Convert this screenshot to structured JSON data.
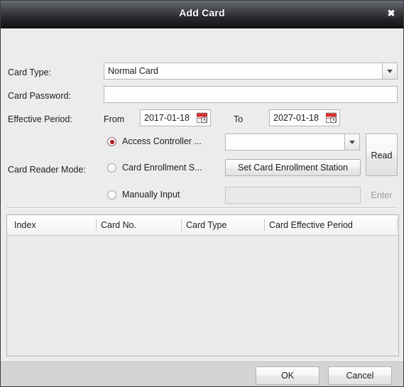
{
  "window": {
    "title": "Add Card",
    "close_icon": "close-icon",
    "close_glyph": "✖"
  },
  "form": {
    "card_type": {
      "label": "Card Type:",
      "value": "Normal Card",
      "arrow_icon": "chevron-down-icon"
    },
    "card_password": {
      "label": "Card Password:",
      "value": "",
      "placeholder": ""
    },
    "effective_period": {
      "label": "Effective Period:",
      "from_label": "From",
      "from_value": "2017-01-18",
      "to_label": "To",
      "to_value": "2027-01-18",
      "calendar_icon": "calendar-icon"
    },
    "card_reader_mode": {
      "label": "Card Reader Mode:",
      "options": [
        {
          "label": "Access Controller ...",
          "selected": true,
          "control": "combo",
          "value": "",
          "arrow_icon": "chevron-down-icon"
        },
        {
          "label": "Card Enrollment S...",
          "selected": false,
          "control": "button",
          "button_label": "Set Card Enrollment Station"
        },
        {
          "label": "Manually Input",
          "selected": false,
          "control": "input",
          "value": "",
          "button_label": "Enter",
          "button_disabled": true
        }
      ],
      "read_button": "Read"
    }
  },
  "table": {
    "columns": [
      "Index",
      "Card No.",
      "Card Type",
      "Card Effective Period"
    ],
    "rows": []
  },
  "footer": {
    "ok_label": "OK",
    "cancel_label": "Cancel"
  },
  "colors": {
    "accent_radio": "#b5161b",
    "titlebar_dark": "#141416",
    "body_bg": "#ececec",
    "footer_bg": "#d4d4d4",
    "table_bg": "#ebebeb"
  }
}
